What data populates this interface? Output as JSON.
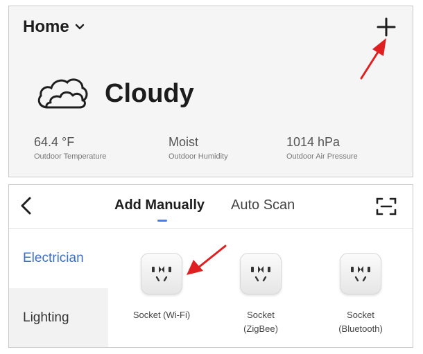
{
  "home": {
    "title": "Home",
    "weather": {
      "condition": "Cloudy"
    },
    "stats": [
      {
        "value": "64.4 °F",
        "label": "Outdoor Temperature"
      },
      {
        "value": "Moist",
        "label": "Outdoor Humidity"
      },
      {
        "value": "1014 hPa",
        "label": "Outdoor Air Pressure"
      }
    ]
  },
  "add_device": {
    "tabs": {
      "manual": "Add Manually",
      "scan": "Auto Scan"
    },
    "sidebar": {
      "electrician": "Electrician",
      "lighting": "Lighting"
    },
    "devices": [
      {
        "line1": "Socket (Wi-Fi)",
        "line2": ""
      },
      {
        "line1": "Socket",
        "line2": "(ZigBee)"
      },
      {
        "line1": "Socket",
        "line2": "(Bluetooth)"
      }
    ]
  },
  "colors": {
    "accent": "#3b82f6",
    "sidebar_active": "#3b6fc4",
    "arrow": "#e02020"
  },
  "icons": [
    "chevron-down-icon",
    "plus-icon",
    "cloud-icon",
    "back-icon",
    "scan-icon",
    "socket-icon",
    "red-arrow-annotation"
  ]
}
